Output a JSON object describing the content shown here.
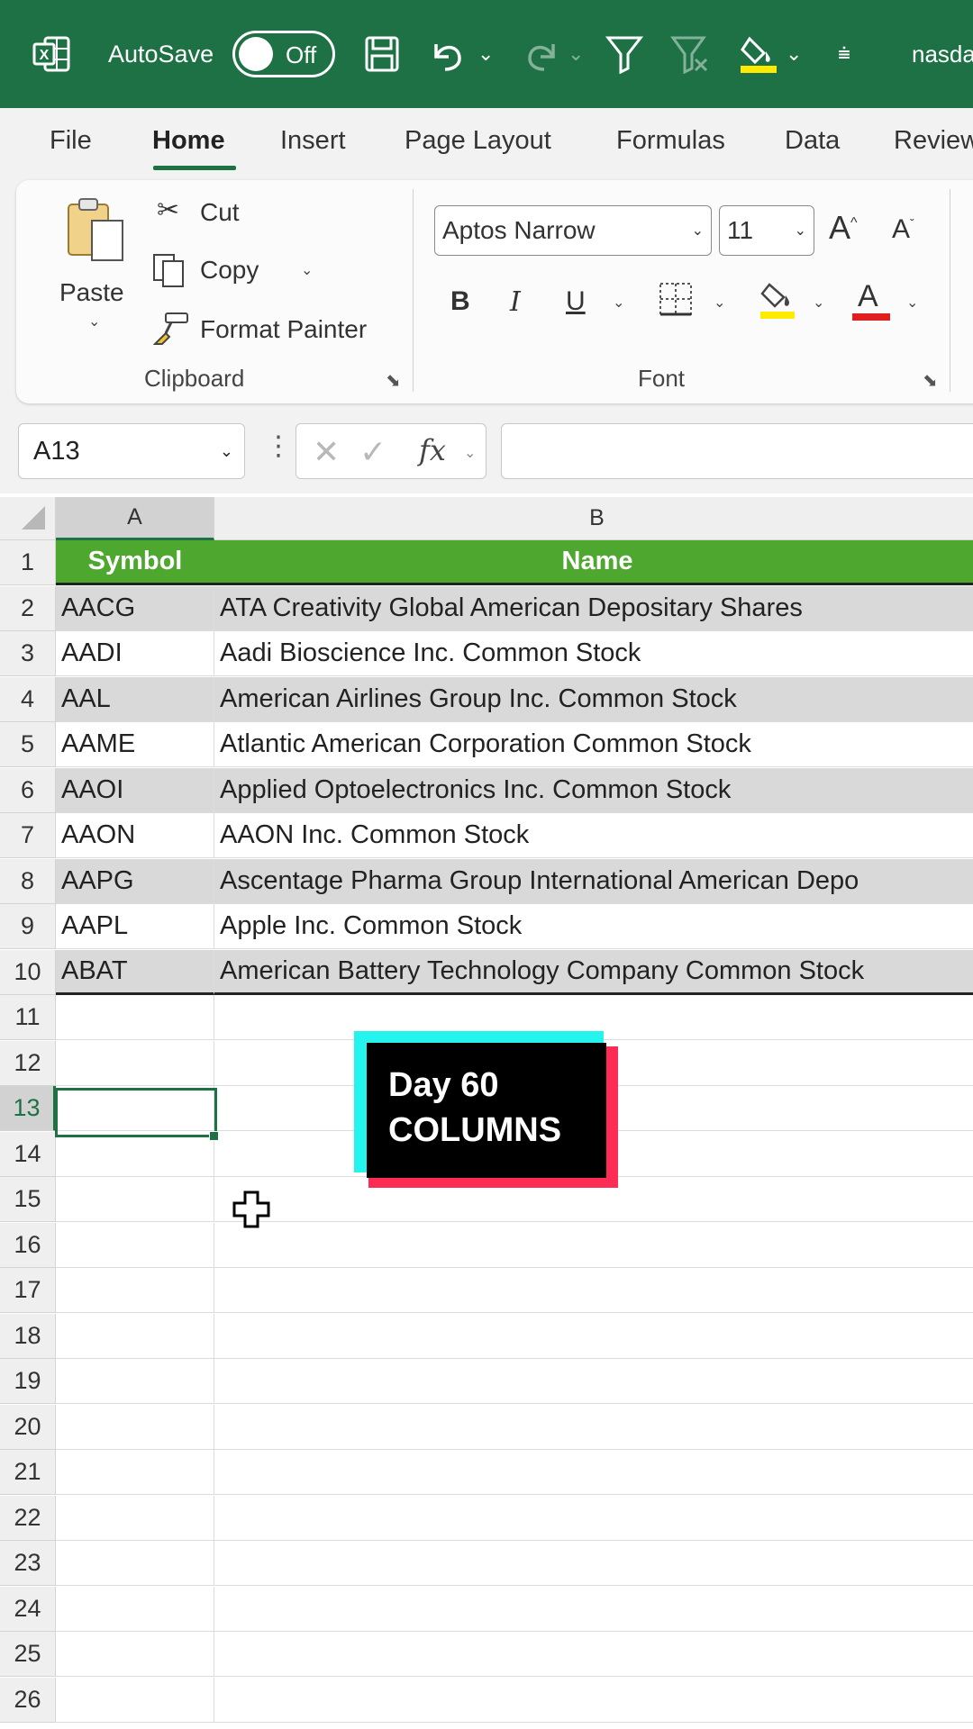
{
  "titlebar": {
    "app_icon": "excel-icon",
    "autosave_label": "AutoSave",
    "autosave_state": "Off",
    "filename": "nasda",
    "accent_color": "#1e7145"
  },
  "tabs": [
    "File",
    "Home",
    "Insert",
    "Page Layout",
    "Formulas",
    "Data",
    "Review"
  ],
  "active_tab": "Home",
  "ribbon": {
    "clipboard": {
      "paste": "Paste",
      "cut": "Cut",
      "copy": "Copy",
      "format_painter": "Format Painter",
      "group_label": "Clipboard"
    },
    "font": {
      "font_name": "Aptos Narrow",
      "font_size": "11",
      "grow": "A",
      "shrink": "A",
      "bold": "B",
      "italic": "I",
      "underline": "U",
      "font_color": "A",
      "group_label": "Font"
    }
  },
  "formula_bar": {
    "name_box": "A13",
    "fx": "fx",
    "value": ""
  },
  "grid": {
    "columns": [
      "A",
      "B"
    ],
    "selected_cell": "A13",
    "header": [
      "Symbol",
      "Name"
    ],
    "rows": [
      [
        "AACG",
        "ATA Creativity Global American Depositary Shares"
      ],
      [
        "AADI",
        "Aadi Bioscience Inc. Common Stock"
      ],
      [
        "AAL",
        "American Airlines Group Inc. Common Stock"
      ],
      [
        "AAME",
        "Atlantic American Corporation Common Stock"
      ],
      [
        "AAOI",
        "Applied Optoelectronics Inc. Common Stock"
      ],
      [
        "AAON",
        "AAON Inc. Common Stock"
      ],
      [
        "AAPG",
        "Ascentage Pharma Group International American Depo"
      ],
      [
        "AAPL",
        "Apple Inc. Common Stock"
      ],
      [
        "ABAT",
        "American Battery Technology Company Common Stock"
      ]
    ],
    "row_numbers": [
      "1",
      "2",
      "3",
      "4",
      "5",
      "6",
      "7",
      "8",
      "9",
      "10",
      "11",
      "12",
      "13",
      "14",
      "15",
      "16",
      "17",
      "18",
      "19",
      "20",
      "21",
      "22",
      "23",
      "24",
      "25",
      "26"
    ],
    "header_color": "#4ea72e",
    "band_color": "#d9d9d9"
  },
  "overlay": {
    "line1": "Day 60",
    "line2": "COLUMNS"
  }
}
